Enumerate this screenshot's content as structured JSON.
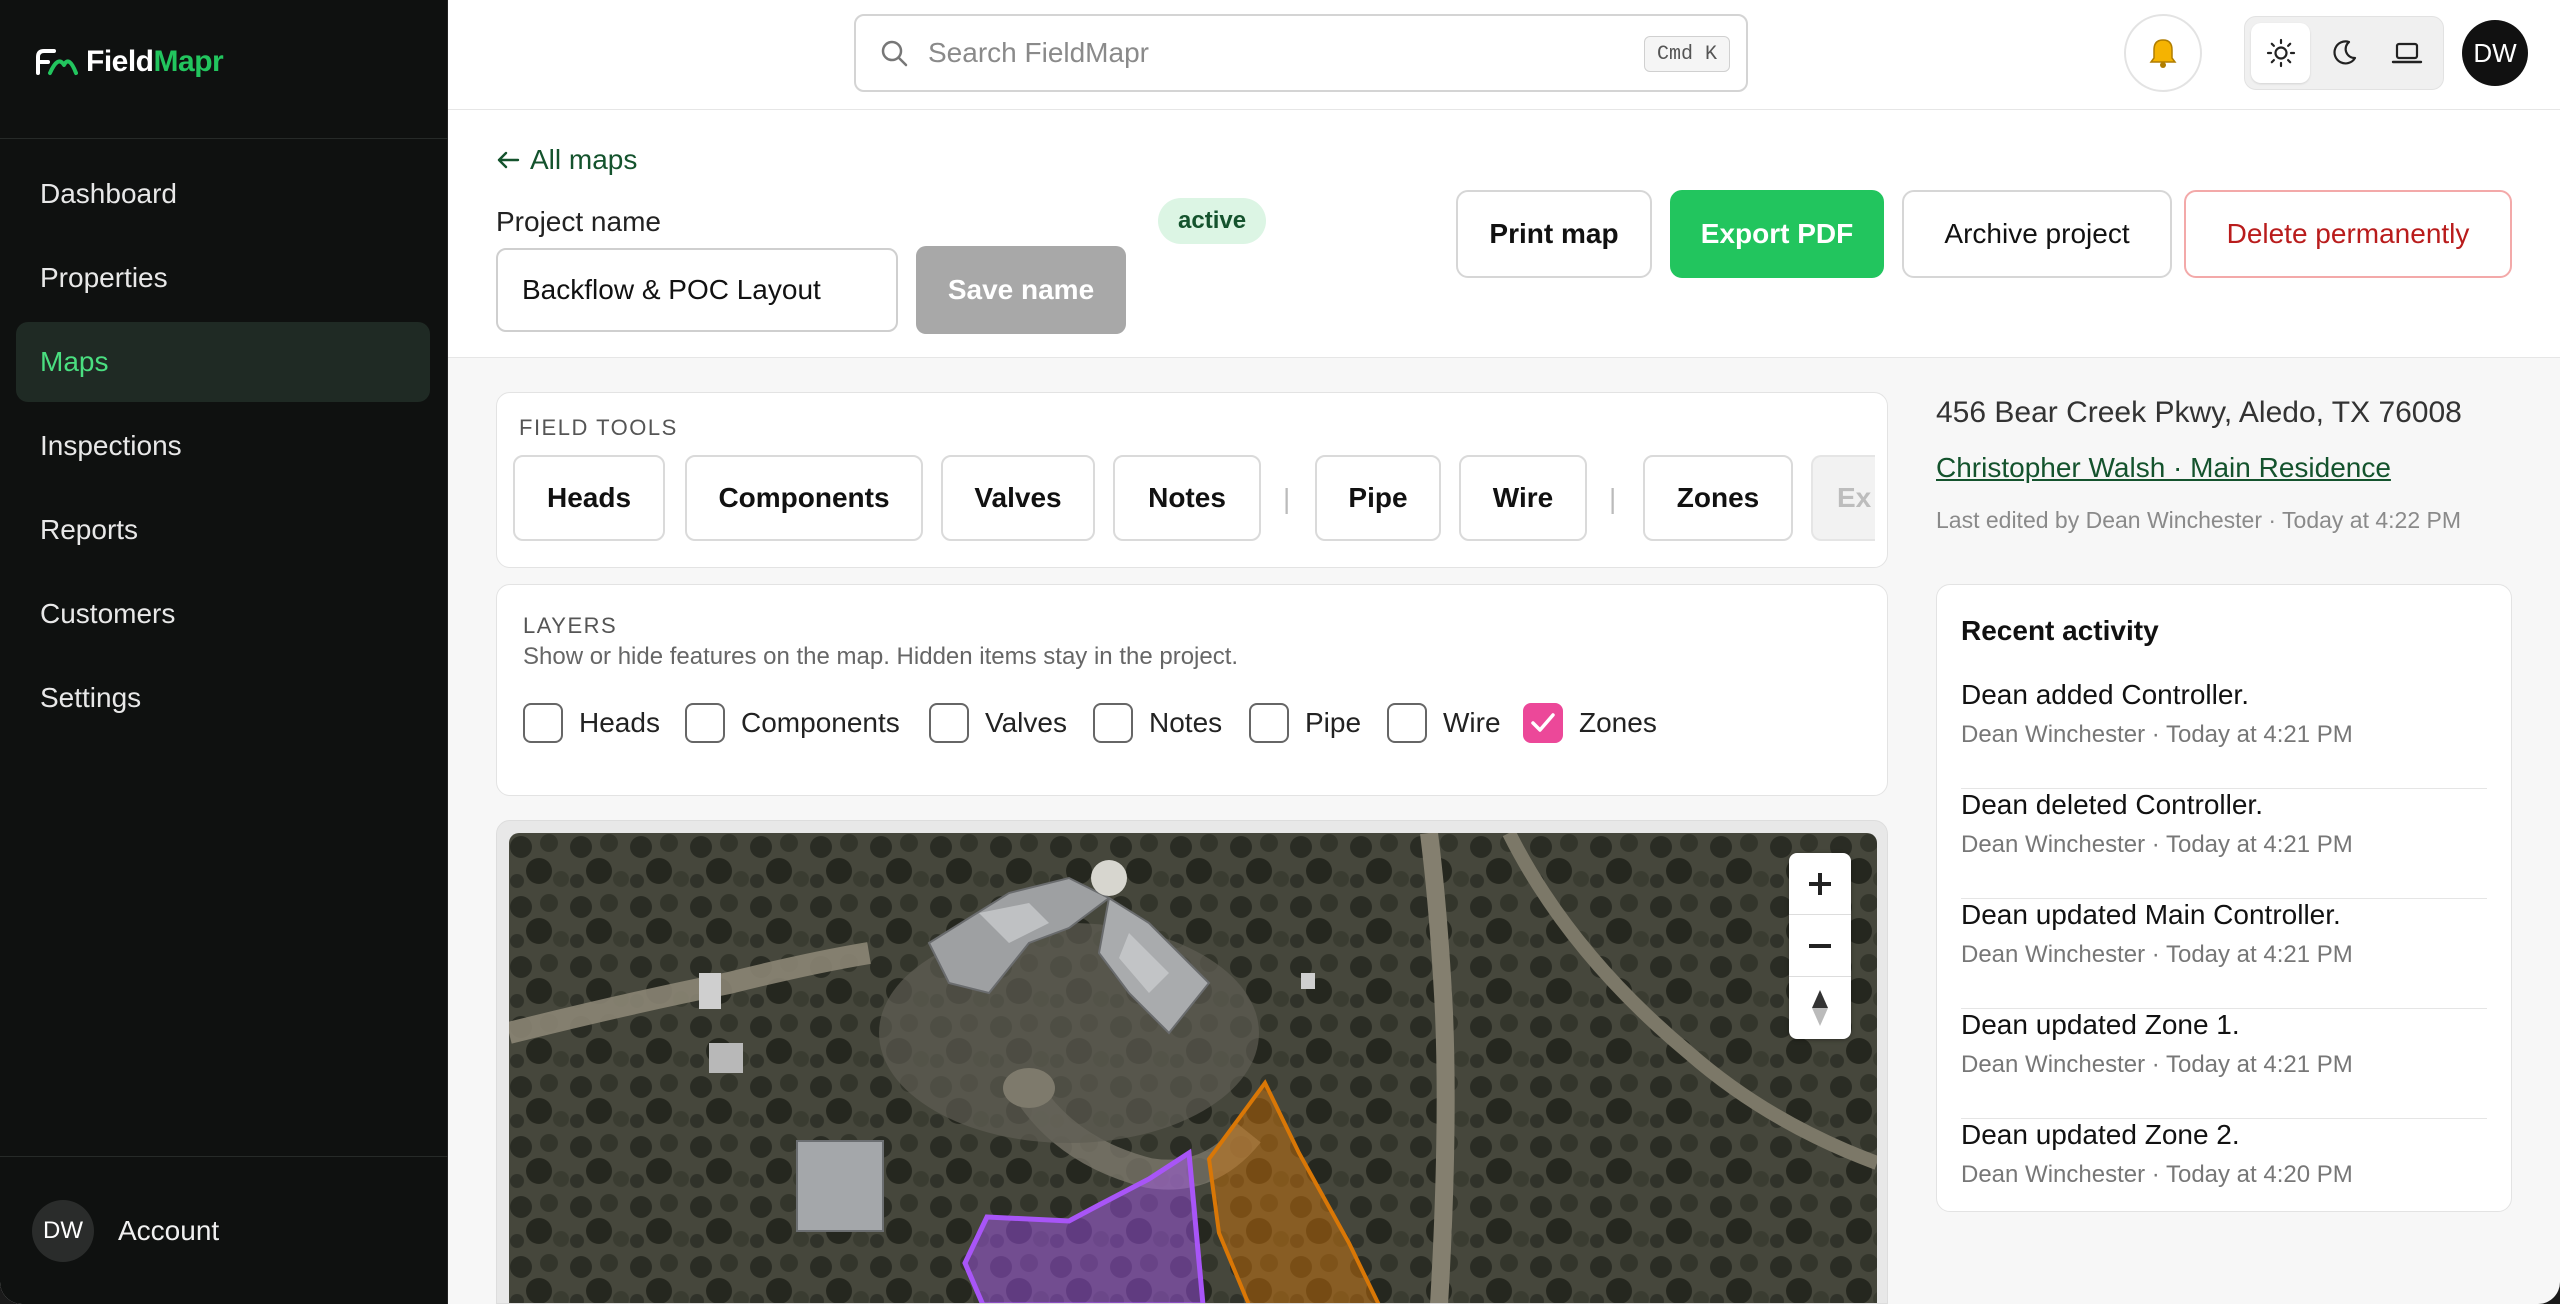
{
  "brand": {
    "name_part1": "Field",
    "name_part2": "Mapr",
    "accent_color": "#22c55e"
  },
  "sidebar": {
    "items": [
      {
        "label": "Dashboard",
        "active": false
      },
      {
        "label": "Properties",
        "active": false
      },
      {
        "label": "Maps",
        "active": true
      },
      {
        "label": "Inspections",
        "active": false
      },
      {
        "label": "Reports",
        "active": false
      },
      {
        "label": "Customers",
        "active": false
      },
      {
        "label": "Settings",
        "active": false
      }
    ],
    "account": {
      "initials": "DW",
      "label": "Account"
    }
  },
  "topbar": {
    "search_placeholder": "Search FieldMapr",
    "search_shortcut": "Cmd K",
    "user_initials": "DW",
    "theme_options": [
      "sun-icon",
      "moon-icon",
      "laptop-icon"
    ],
    "theme_selected": "sun-icon"
  },
  "header": {
    "back_label": "All maps",
    "project_name_label": "Project name",
    "project_name_value": "Backflow & POC Layout",
    "save_label": "Save name",
    "status": "active",
    "print_label": "Print map",
    "export_label": "Export PDF",
    "archive_label": "Archive project",
    "delete_label": "Delete permanently"
  },
  "field_tools": {
    "title": "FIELD TOOLS",
    "group1": [
      "Heads",
      "Components",
      "Valves",
      "Notes"
    ],
    "group2": [
      "Pipe",
      "Wire"
    ],
    "group3": [
      "Zones"
    ],
    "overflow": "Ex",
    "separator": "|"
  },
  "layers": {
    "title": "LAYERS",
    "description": "Show or hide features on the map. Hidden items stay in the project.",
    "items": [
      {
        "label": "Heads",
        "checked": false
      },
      {
        "label": "Components",
        "checked": false
      },
      {
        "label": "Valves",
        "checked": false
      },
      {
        "label": "Notes",
        "checked": false
      },
      {
        "label": "Pipe",
        "checked": false
      },
      {
        "label": "Wire",
        "checked": false
      },
      {
        "label": "Zones",
        "checked": true
      }
    ],
    "checked_color": "#ec4899"
  },
  "property": {
    "address": "456 Bear Creek Pkwy, Aledo, TX 76008",
    "owner_link": "Christopher Walsh · Main Residence",
    "last_edited": "Last edited by Dean Winchester · Today at 4:22 PM"
  },
  "activity": {
    "title": "Recent activity",
    "items": [
      {
        "text": "Dean added Controller.",
        "meta": "Dean Winchester · Today at 4:21 PM"
      },
      {
        "text": "Dean deleted Controller.",
        "meta": "Dean Winchester · Today at 4:21 PM"
      },
      {
        "text": "Dean updated Main Controller.",
        "meta": "Dean Winchester · Today at 4:21 PM"
      },
      {
        "text": "Dean updated Zone 1.",
        "meta": "Dean Winchester · Today at 4:21 PM"
      },
      {
        "text": "Dean updated Zone 2.",
        "meta": "Dean Winchester · Today at 4:20 PM"
      }
    ]
  },
  "map": {
    "zone_colors": {
      "purple": "#a855f7",
      "orange": "#d97706"
    },
    "controls": [
      "zoom-in-icon",
      "zoom-out-icon",
      "compass-icon"
    ]
  }
}
